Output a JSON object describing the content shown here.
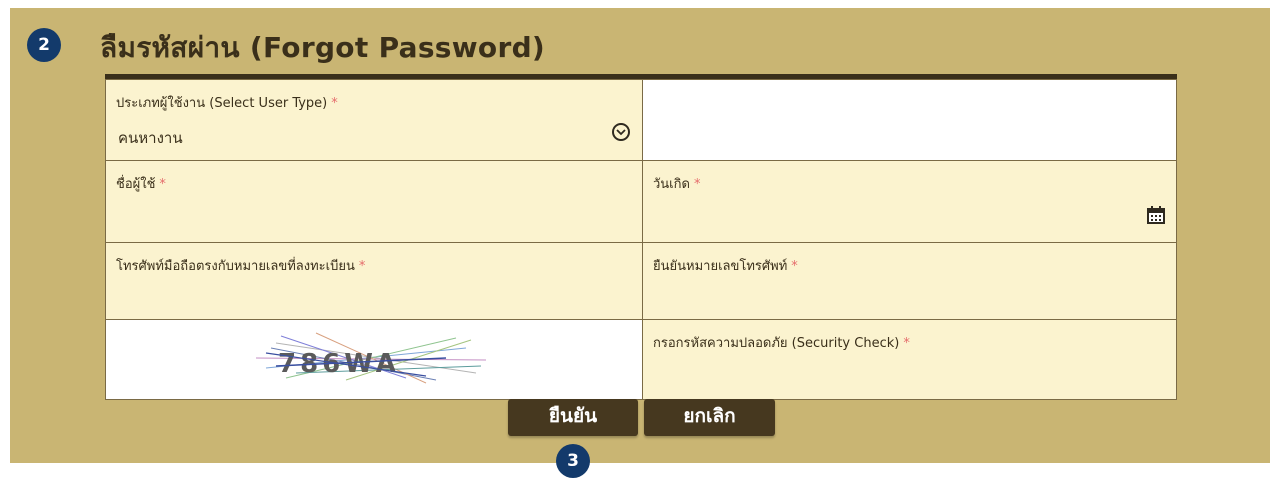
{
  "badges": {
    "top": "2",
    "bottom": "3"
  },
  "title": "ลืมรหัสผ่าน (Forgot Password)",
  "required_mark": "*",
  "fields": {
    "user_type": {
      "label": "ประเภทผู้ใช้งาน (Select User Type)",
      "value": "คนหางาน"
    },
    "username": {
      "label": "ชื่อผู้ใช้"
    },
    "birthdate": {
      "label": "วันเกิด"
    },
    "phone": {
      "label": "โทรศัพท์มือถือตรงกับหมายเลขที่ลงทะเบียน"
    },
    "phone_confirm": {
      "label": "ยืนยันหมายเลขโทรศัพท์"
    },
    "security": {
      "label": "กรอกรหัสความปลอดภัย (Security Check)"
    }
  },
  "captcha": {
    "text": "786WA"
  },
  "buttons": {
    "confirm": "ยืนยัน",
    "cancel": "ยกเลิก"
  },
  "colors": {
    "panel": "#c9b573",
    "field_bg": "#fbf3cf",
    "button": "#46381f",
    "badge": "#133a6b",
    "required": "#e56b6b"
  }
}
